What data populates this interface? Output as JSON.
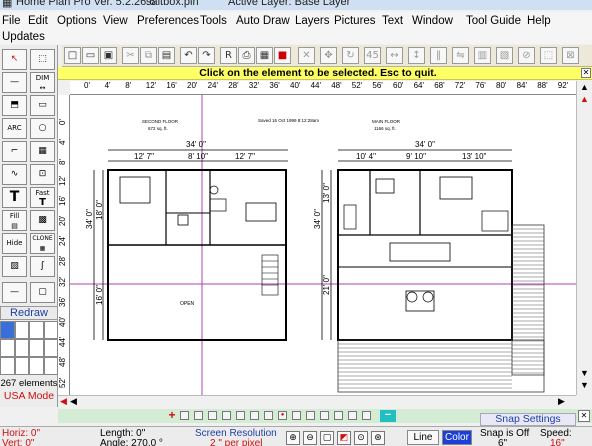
{
  "window": {
    "title_app": "Home Plan Pro Ver. 5.2.26.6",
    "title_file": "saltbox.pln",
    "title_layer": "Active Layer: Base Layer"
  },
  "menu": {
    "file": "File",
    "edit": "Edit",
    "options": "Options",
    "view": "View",
    "preferences": "Preferences",
    "tools": "Tools",
    "auto_draw": "Auto Draw",
    "layers": "Layers",
    "pictures": "Pictures",
    "text": "Text",
    "window": "Window",
    "tool_guide": "Tool Guide",
    "help": "Help",
    "updates": "Updates"
  },
  "hint": {
    "message": "Click on the element to be selected.  Esc to quit.",
    "close": "✕"
  },
  "left_tools": {
    "dim_label": "DIM",
    "fast_label": "Fast",
    "fill_label": "Fill",
    "clone_label": "CLONE",
    "hide_label": "Hide",
    "arc_label": "ARC",
    "redraw": "Redraw",
    "element_count": "267 elements",
    "mode": "USA Mode"
  },
  "rulers": {
    "top": [
      "0'",
      "4'",
      "8'",
      "12'",
      "16'",
      "20'",
      "24'",
      "28'",
      "32'",
      "36'",
      "40'",
      "44'",
      "48'",
      "52'",
      "56'",
      "60'",
      "64'",
      "68'",
      "72'",
      "76'",
      "80'",
      "84'",
      "88'",
      "92'",
      "96'"
    ],
    "left": [
      "0'",
      "4'",
      "8'",
      "12'",
      "16'",
      "20'",
      "24'",
      "28'",
      "32'",
      "36'",
      "40'",
      "44'",
      "48'",
      "52'"
    ]
  },
  "plan": {
    "second_floor_title": "SECOND FLOOR",
    "second_floor_area": "672 sq. ft.",
    "saved_note": "Saved 16 Oct 1999  8:12:28am",
    "main_floor_title": "MAIN FLOOR",
    "main_floor_area": "1166 sq. ft.",
    "sf_total_width": "34' 0\"",
    "sf_seg1": "12' 7\"",
    "sf_seg2": "8' 10\"",
    "sf_seg3": "12' 7\"",
    "sf_side_top": "18' 0\"",
    "sf_side_total": "34' 0\"",
    "sf_side_bottom": "16' 0\"",
    "open_label": "OPEN",
    "mf_total_width": "34' 0\"",
    "mf_seg1": "10' 4\"",
    "mf_seg2": "9' 10\"",
    "mf_seg3": "13' 10\"",
    "mf_side_top": "13' 0\"",
    "mf_side_total": "34' 0\"",
    "mf_side_bottom": "21' 0\""
  },
  "bottom": {
    "snap_settings": "Snap Settings",
    "close": "✕",
    "horiz_label": "Horiz: 0\"",
    "vert_label": "Vert: 0\"",
    "length_label": "Length: 0\"",
    "angle_label": "Angle: 270.0 °",
    "screen_resolution": "Screen Resolution",
    "per_pixel": "2 \" per pixel",
    "line_button": "Line",
    "color_button": "Color",
    "snap_status": "Snap is Off",
    "snap_value": "6\"",
    "speed_label": "Speed:",
    "speed_value": "16\""
  }
}
